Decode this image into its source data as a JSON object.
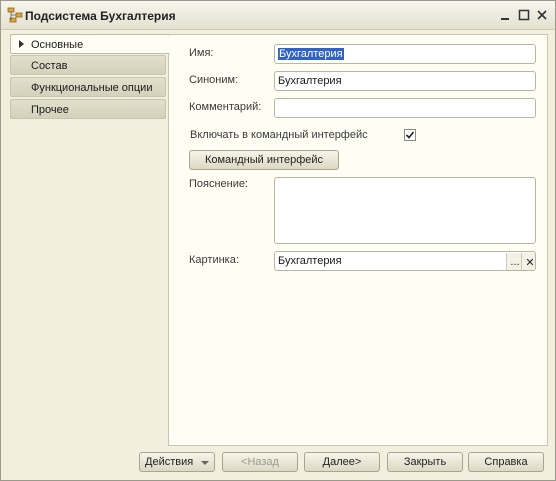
{
  "window": {
    "title": "Подсистема Бухгалтерия"
  },
  "icons": {
    "app": "subsystem-icon",
    "minimize": "minimize-icon",
    "maximize": "maximize-icon",
    "close": "close-icon"
  },
  "sidebar": {
    "items": [
      {
        "label": "Основные",
        "active": true
      },
      {
        "label": "Состав",
        "active": false
      },
      {
        "label": "Функциональные опции",
        "active": false
      },
      {
        "label": "Прочее",
        "active": false
      }
    ]
  },
  "form": {
    "name_label": "Имя:",
    "name_value": "Бухгалтерия",
    "synonym_label": "Синоним:",
    "synonym_value": "Бухгалтерия",
    "comment_label": "Комментарий:",
    "comment_value": "",
    "include_label": "Включать в командный интерфейс",
    "include_checked": true,
    "command_button": "Командный интерфейс",
    "explanation_label": "Пояснение:",
    "explanation_value": "",
    "picture_label": "Картинка:",
    "picture_value": "Бухгалтерия",
    "picture_select": "...",
    "picture_clear": "✕"
  },
  "footer": {
    "actions": "Действия",
    "back": "<Назад",
    "next": "Далее>",
    "close": "Закрыть",
    "help": "Справка"
  },
  "colors": {
    "accent_selection": "#3163c6",
    "panel_bg": "#fffef5",
    "window_bg": "#f2efdf"
  }
}
